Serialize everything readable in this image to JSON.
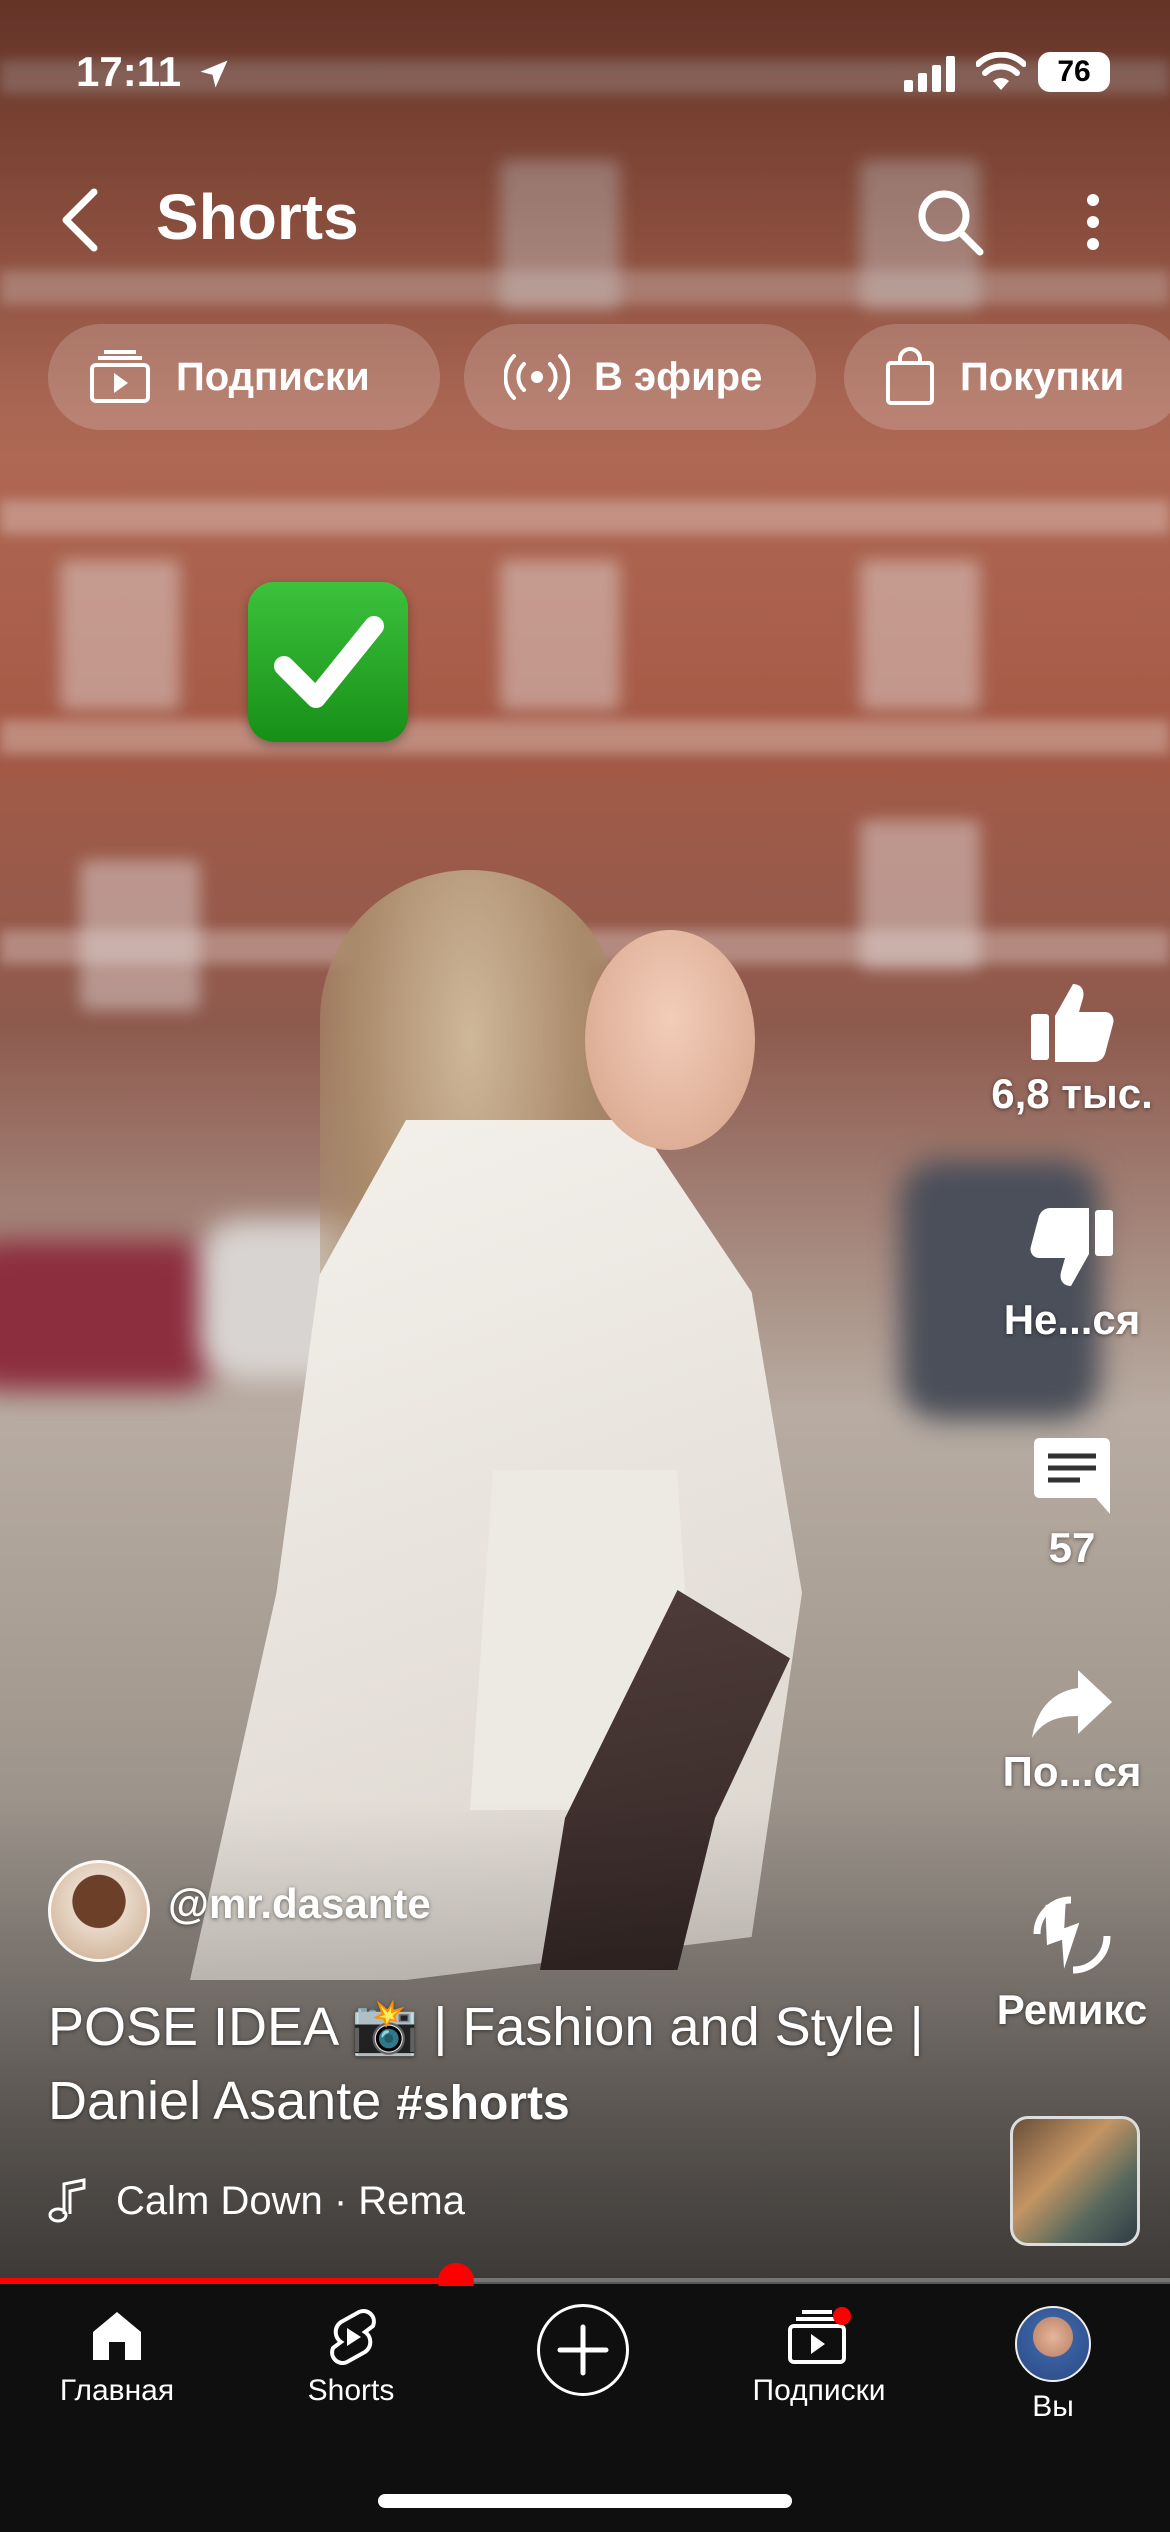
{
  "status_bar": {
    "time": "17:11",
    "battery": "76"
  },
  "header": {
    "title": "Shorts"
  },
  "chips": [
    {
      "label": "Подписки",
      "icon": "subscriptions-icon"
    },
    {
      "label": "В эфире",
      "icon": "live-icon"
    },
    {
      "label": "Покупки",
      "icon": "shopping-bag-icon"
    }
  ],
  "overlay_emoji": "check-mark-button-icon",
  "actions": {
    "like": "6,8 тыс.",
    "dislike": "Не...ся",
    "comments": "57",
    "share": "По...ся",
    "remix": "Ремикс"
  },
  "video": {
    "channel": "@mr.dasante",
    "title_text": "POSE IDEA 📸 | Fashion and Style | Daniel Asante",
    "hashtag": "#shorts",
    "music": "Calm Down · Rema",
    "progress": 0.39
  },
  "nav": {
    "home": "Главная",
    "shorts": "Shorts",
    "subscriptions": "Подписки",
    "you": "Вы"
  },
  "colors": {
    "accent": "#ff0000",
    "nav_bg": "#0f0f0f"
  }
}
